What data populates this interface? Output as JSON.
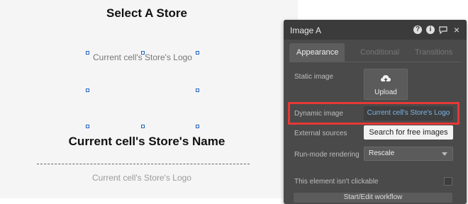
{
  "canvas": {
    "page_title": "Select A Store",
    "image_placeholder": "Current cell's Store's Logo",
    "store_name": "Current cell's Store's Name",
    "repeat_logo": "Current cell's Store's Logo"
  },
  "panel": {
    "title": "Image A",
    "header_icons": [
      "help-icon",
      "info-icon",
      "comment-icon",
      "close-icon"
    ],
    "tabs": [
      {
        "label": "Appearance",
        "active": true
      },
      {
        "label": "Conditional",
        "active": false
      },
      {
        "label": "Transitions",
        "active": false
      }
    ],
    "static_image_label": "Static image",
    "upload_label": "Upload",
    "dynamic_image_label": "Dynamic image",
    "dynamic_image_value": "Current cell's Store's Logo",
    "external_sources_label": "External sources",
    "search_button_label": "Search for free images",
    "run_mode_label": "Run-mode rendering",
    "run_mode_value": "Rescale",
    "not_clickable_label": "This element isn't clickable",
    "bottom_button_label": "Start/Edit workflow"
  },
  "colors": {
    "panel_bg": "#4a4a4a",
    "highlight": "#e53935",
    "link_blue": "#7bb6e8",
    "selection_handle": "#1f5fbf"
  }
}
